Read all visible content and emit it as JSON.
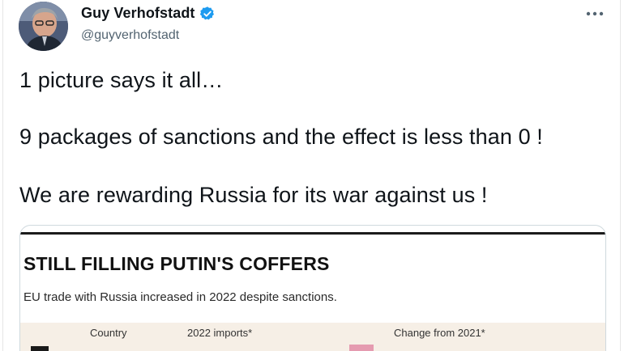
{
  "tweet": {
    "display_name": "Guy Verhofstadt",
    "handle": "@guyverhofstadt",
    "more_label": "···",
    "lines": [
      "1 picture says it all…",
      "9 packages of sanctions and the effect is less than 0 !",
      "We are rewarding Russia for its war against us !"
    ]
  },
  "media": {
    "title": "STILL FILLING PUTIN'S COFFERS",
    "subtitle": "EU trade with Russia increased in 2022 despite sanctions.",
    "columns": [
      "Country",
      "2022 imports*",
      "Change from 2021*"
    ]
  },
  "colors": {
    "verified": "#1d9bf0",
    "text_primary": "#0f1419",
    "text_secondary": "#536471",
    "table_header_bg": "#f6efe6",
    "bar_pink": "#e59bb0"
  }
}
